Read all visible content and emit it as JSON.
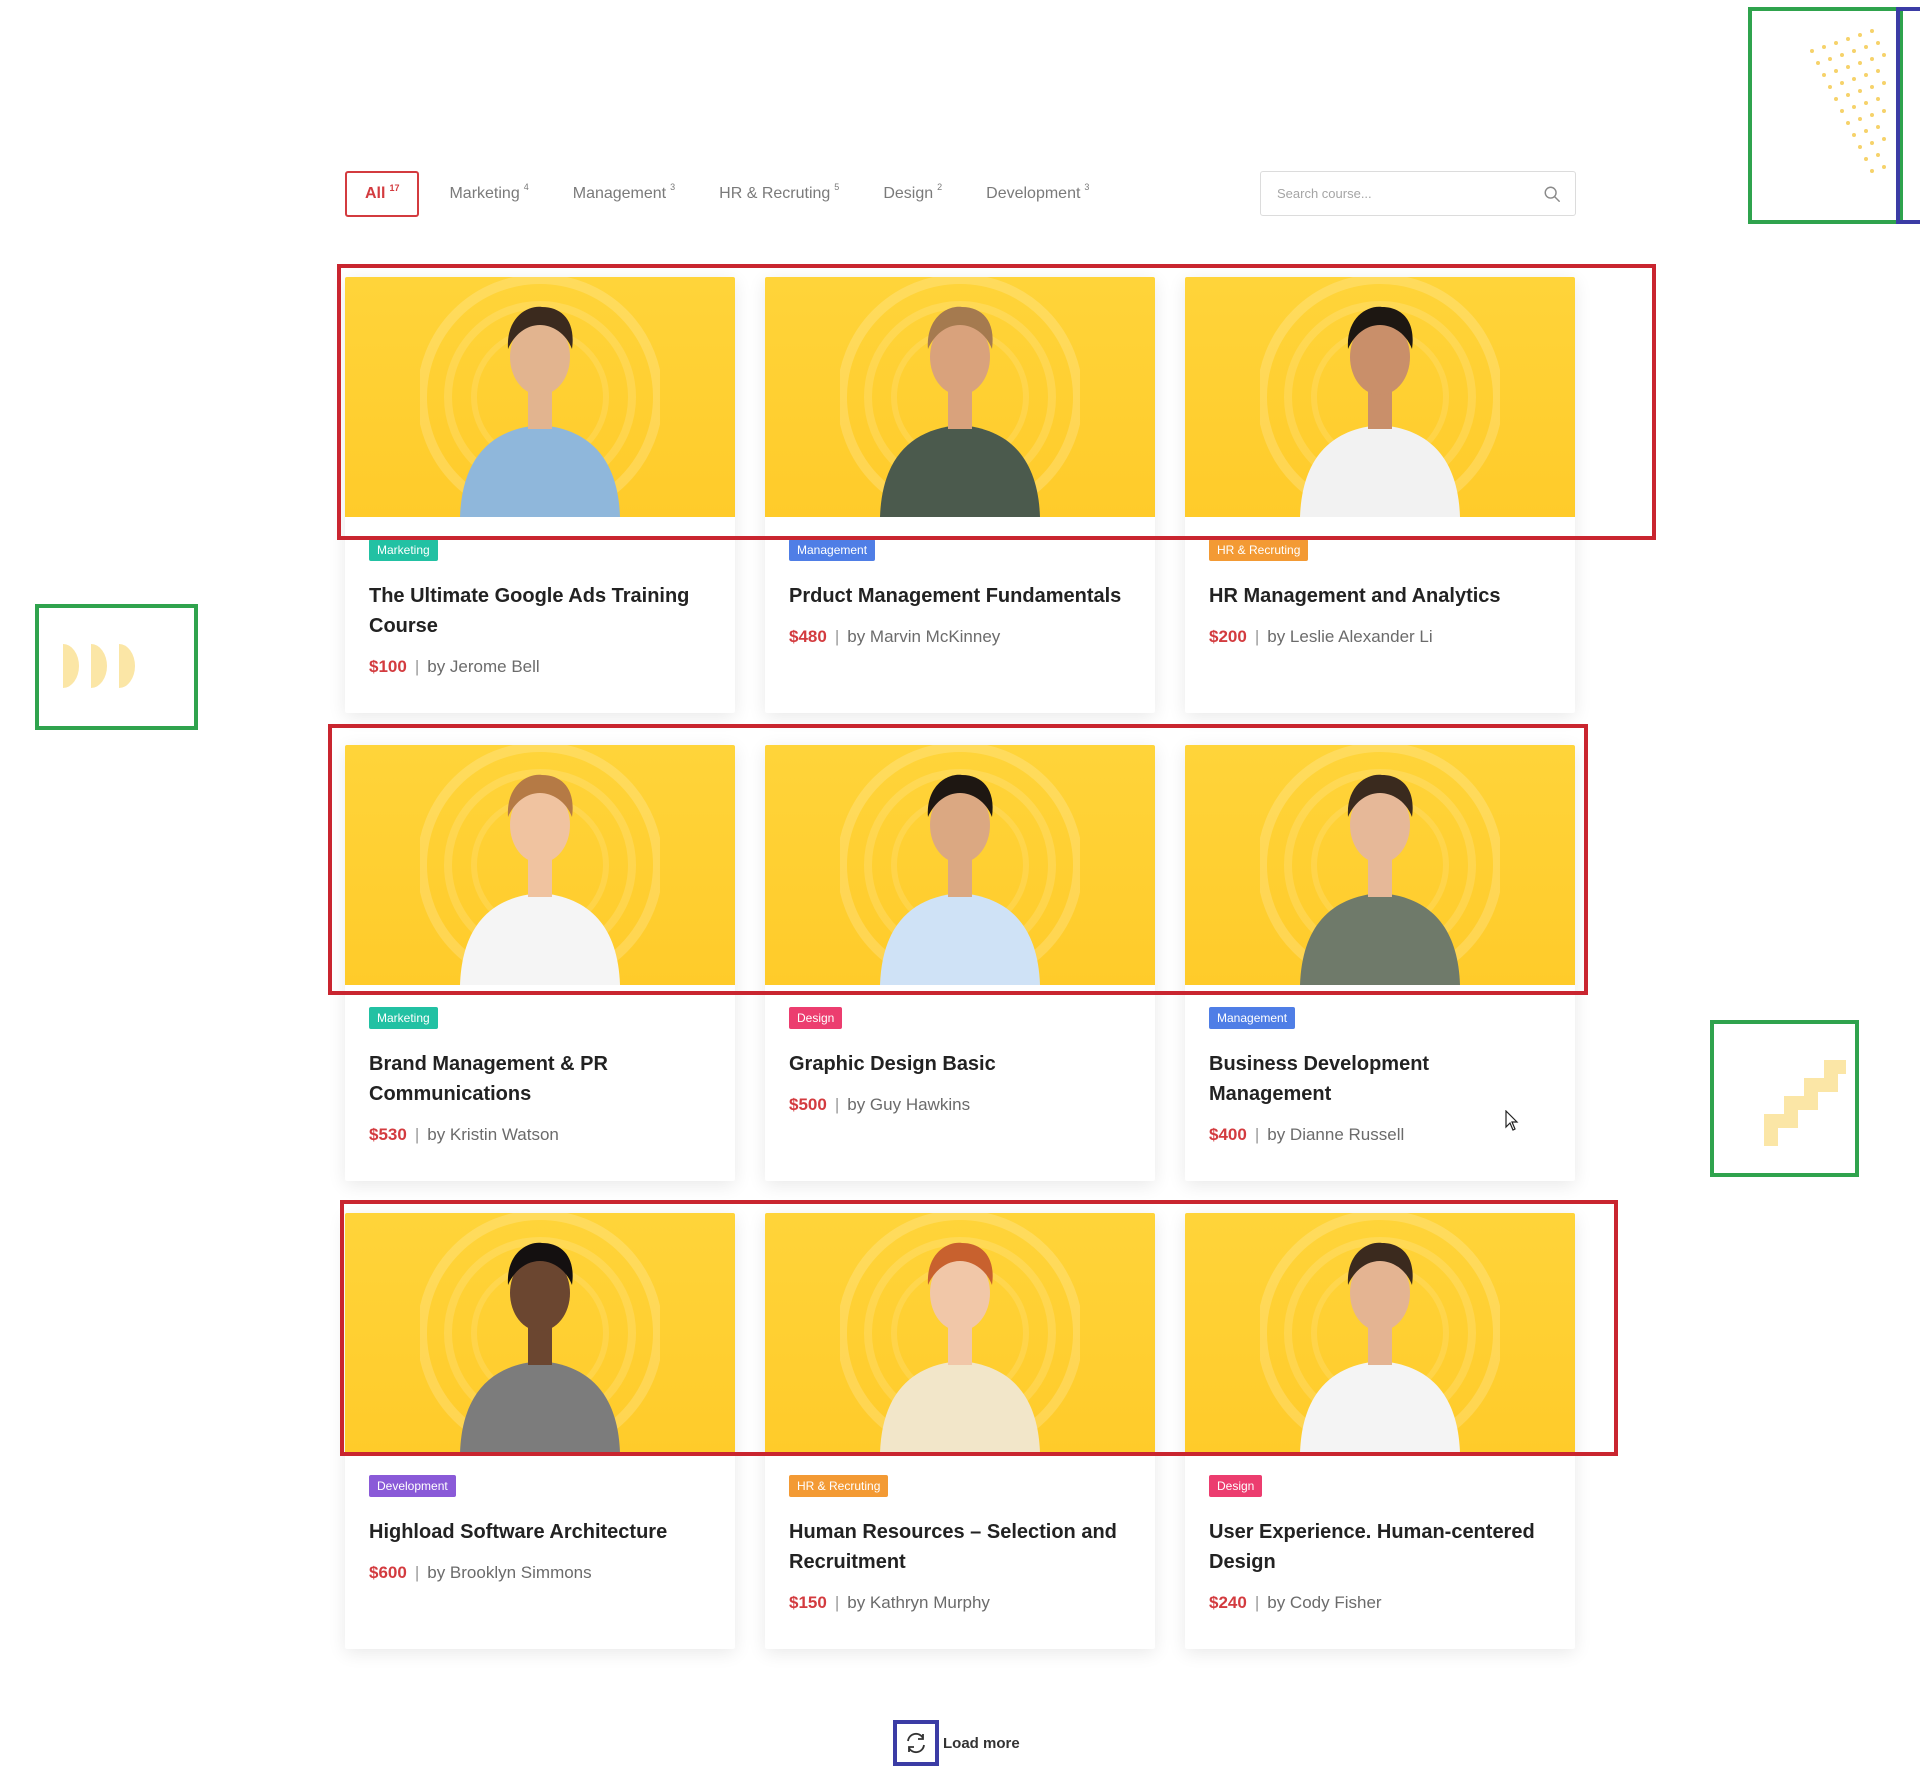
{
  "filters": [
    {
      "label": "All",
      "count": "17",
      "active": true
    },
    {
      "label": "Marketing",
      "count": "4"
    },
    {
      "label": "Management",
      "count": "3"
    },
    {
      "label": "HR & Recruting",
      "count": "5"
    },
    {
      "label": "Design",
      "count": "2"
    },
    {
      "label": "Development",
      "count": "3"
    }
  ],
  "search": {
    "placeholder": "Search course..."
  },
  "courses": [
    {
      "tag": "Marketing",
      "tag_color": "#22c1a3",
      "title": "The Ultimate Google Ads Training Course",
      "price": "$100",
      "author": "by Jerome Bell"
    },
    {
      "tag": "Management",
      "tag_color": "#4f7ee6",
      "title": "Prduct Management Fundamentals",
      "price": "$480",
      "author": "by Marvin McKinney"
    },
    {
      "tag": "HR & Recruting",
      "tag_color": "#f39a34",
      "title": "HR  Management and Analytics",
      "price": "$200",
      "author": "by Leslie Alexander Li"
    },
    {
      "tag": "Marketing",
      "tag_color": "#22c1a3",
      "title": "Brand Management & PR Communications",
      "price": "$530",
      "author": "by Kristin Watson"
    },
    {
      "tag": "Design",
      "tag_color": "#ec3d6f",
      "title": "Graphic Design Basic",
      "price": "$500",
      "author": "by Guy Hawkins"
    },
    {
      "tag": "Management",
      "tag_color": "#4f7ee6",
      "title": "Business Development Management",
      "price": "$400",
      "author": "by Dianne Russell"
    },
    {
      "tag": "Development",
      "tag_color": "#8a5ad8",
      "title": "Highload Software Architecture",
      "price": "$600",
      "author": "by Brooklyn Simmons"
    },
    {
      "tag": "HR & Recruting",
      "tag_color": "#f39a34",
      "title": "Human Resources – Selection and Recruitment",
      "price": "$150",
      "author": "by Kathryn Murphy"
    },
    {
      "tag": "Design",
      "tag_color": "#ec3d6f",
      "title": "User Experience. Human-centered Design",
      "price": "$240",
      "author": "by Cody Fisher"
    }
  ],
  "load_more": {
    "label": "Load more"
  },
  "colors": {
    "accent": "#d33b3f",
    "card_bg": "#ffcc2f"
  }
}
